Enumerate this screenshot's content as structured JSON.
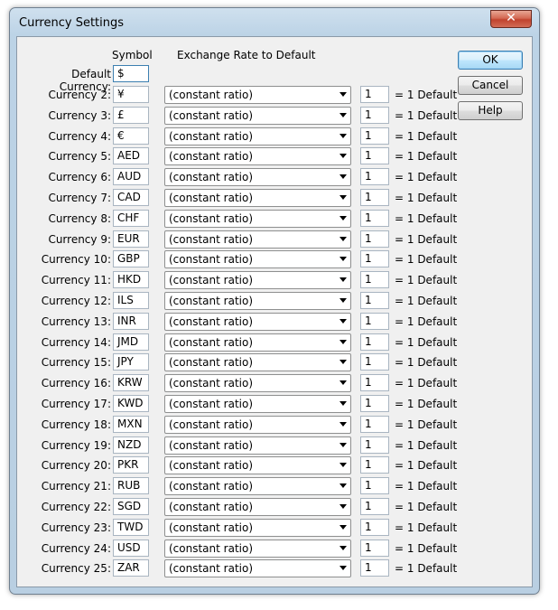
{
  "window": {
    "title": "Currency Settings",
    "close_glyph": "✕"
  },
  "headers": {
    "symbol": "Symbol",
    "rate": "Exchange Rate to Default"
  },
  "default_currency": {
    "label": "Default Currency:",
    "symbol": "$"
  },
  "buttons": {
    "ok": "OK",
    "cancel": "Cancel",
    "help": "Help"
  },
  "suffix": "= 1 Default",
  "currencies": [
    {
      "label": "Currency 2:",
      "symbol": "¥",
      "ratio": "(constant ratio)",
      "rate": "1"
    },
    {
      "label": "Currency 3:",
      "symbol": "£",
      "ratio": "(constant ratio)",
      "rate": "1"
    },
    {
      "label": "Currency 4:",
      "symbol": "€",
      "ratio": "(constant ratio)",
      "rate": "1"
    },
    {
      "label": "Currency 5:",
      "symbol": "AED",
      "ratio": "(constant ratio)",
      "rate": "1"
    },
    {
      "label": "Currency 6:",
      "symbol": "AUD",
      "ratio": "(constant ratio)",
      "rate": "1"
    },
    {
      "label": "Currency 7:",
      "symbol": "CAD",
      "ratio": "(constant ratio)",
      "rate": "1"
    },
    {
      "label": "Currency 8:",
      "symbol": "CHF",
      "ratio": "(constant ratio)",
      "rate": "1"
    },
    {
      "label": "Currency 9:",
      "symbol": "EUR",
      "ratio": "(constant ratio)",
      "rate": "1"
    },
    {
      "label": "Currency 10:",
      "symbol": "GBP",
      "ratio": "(constant ratio)",
      "rate": "1"
    },
    {
      "label": "Currency 11:",
      "symbol": "HKD",
      "ratio": "(constant ratio)",
      "rate": "1"
    },
    {
      "label": "Currency 12:",
      "symbol": "ILS",
      "ratio": "(constant ratio)",
      "rate": "1"
    },
    {
      "label": "Currency 13:",
      "symbol": "INR",
      "ratio": "(constant ratio)",
      "rate": "1"
    },
    {
      "label": "Currency 14:",
      "symbol": "JMD",
      "ratio": "(constant ratio)",
      "rate": "1"
    },
    {
      "label": "Currency 15:",
      "symbol": "JPY",
      "ratio": "(constant ratio)",
      "rate": "1"
    },
    {
      "label": "Currency 16:",
      "symbol": "KRW",
      "ratio": "(constant ratio)",
      "rate": "1"
    },
    {
      "label": "Currency 17:",
      "symbol": "KWD",
      "ratio": "(constant ratio)",
      "rate": "1"
    },
    {
      "label": "Currency 18:",
      "symbol": "MXN",
      "ratio": "(constant ratio)",
      "rate": "1"
    },
    {
      "label": "Currency 19:",
      "symbol": "NZD",
      "ratio": "(constant ratio)",
      "rate": "1"
    },
    {
      "label": "Currency 20:",
      "symbol": "PKR",
      "ratio": "(constant ratio)",
      "rate": "1"
    },
    {
      "label": "Currency 21:",
      "symbol": "RUB",
      "ratio": "(constant ratio)",
      "rate": "1"
    },
    {
      "label": "Currency 22:",
      "symbol": "SGD",
      "ratio": "(constant ratio)",
      "rate": "1"
    },
    {
      "label": "Currency 23:",
      "symbol": "TWD",
      "ratio": "(constant ratio)",
      "rate": "1"
    },
    {
      "label": "Currency 24:",
      "symbol": "USD",
      "ratio": "(constant ratio)",
      "rate": "1"
    },
    {
      "label": "Currency 25:",
      "symbol": "ZAR",
      "ratio": "(constant ratio)",
      "rate": "1"
    }
  ]
}
